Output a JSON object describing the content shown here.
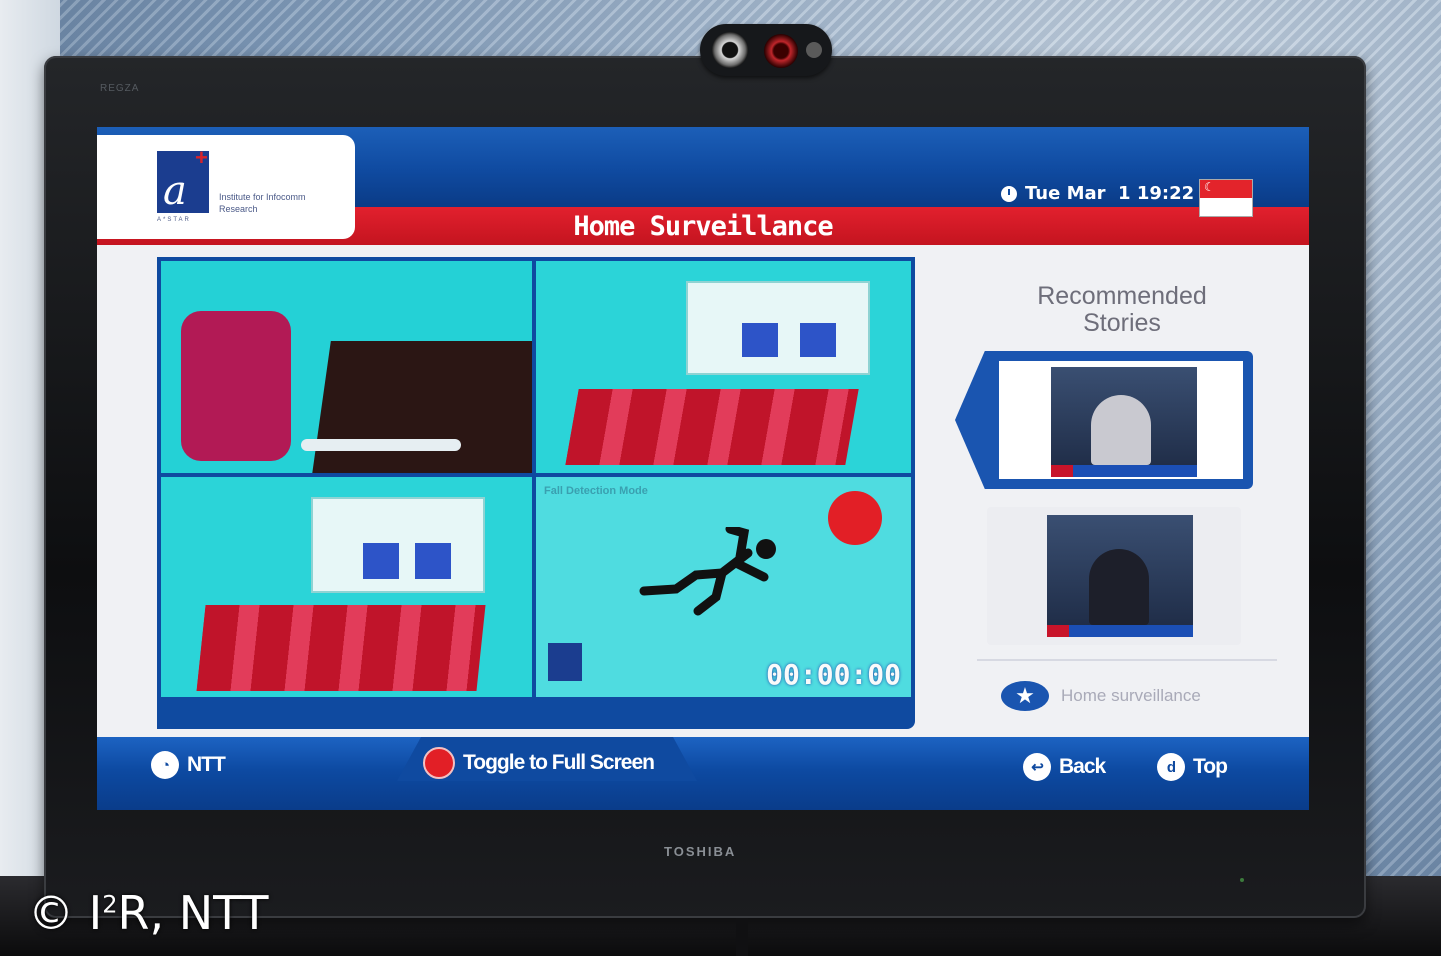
{
  "header": {
    "logo_text": "Institute for Infocomm Research",
    "logo_sub": "A*STAR",
    "title": "Home Surveillance",
    "datetime": "Tue Mar  1 19:22"
  },
  "video": {
    "overlay_label": "Fall Detection Mode",
    "timecode": "00:00:00"
  },
  "sidebar": {
    "heading": "Recommended Stories",
    "home_link": "Home surveillance"
  },
  "footer": {
    "ntt": "NTT",
    "toggle": "Toggle to Full Screen",
    "back": "Back",
    "top": "Top"
  },
  "device": {
    "brand": "TOSHIBA",
    "brand_top": "REGZA"
  },
  "copyright": {
    "prefix": "© I",
    "sup": "2",
    "suffix": "R, NTT"
  },
  "colors": {
    "header_blue": "#0f4aa0",
    "header_red": "#d0192a",
    "camera_cyan": "#2ad4d4",
    "alert_red": "#e21f26"
  },
  "icons": [
    "clock-icon",
    "singapore-flag-icon",
    "fall-person-icon",
    "star-icon",
    "back-icon",
    "top-icon",
    "ntt-icon"
  ]
}
